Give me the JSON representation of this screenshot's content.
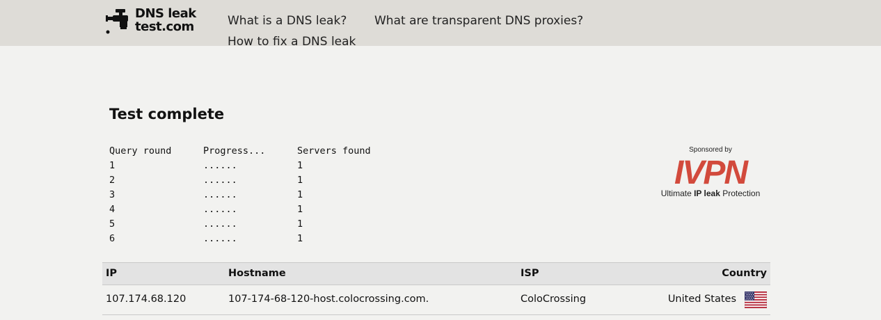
{
  "header": {
    "logo": {
      "line1": "DNS leak",
      "line2": "test.com",
      "icon": "faucet-icon"
    },
    "nav": [
      {
        "label": "What is a DNS leak?"
      },
      {
        "label": "What are transparent DNS proxies?"
      },
      {
        "label": "How to fix a DNS leak"
      }
    ]
  },
  "main": {
    "heading": "Test complete",
    "query_table": {
      "headers": [
        "Query round",
        "Progress...",
        "Servers found"
      ],
      "rows": [
        [
          "1",
          "......",
          "1"
        ],
        [
          "2",
          "......",
          "1"
        ],
        [
          "3",
          "......",
          "1"
        ],
        [
          "4",
          "......",
          "1"
        ],
        [
          "5",
          "......",
          "1"
        ],
        [
          "6",
          "......",
          "1"
        ]
      ]
    },
    "sponsor": {
      "label": "Sponsored by",
      "brand": "IVPN",
      "brand_color": "#d24a3c",
      "tagline_pre": "Ultimate ",
      "tagline_bold": "IP leak",
      "tagline_post": " Protection"
    },
    "results": {
      "headers": {
        "ip": "IP",
        "hostname": "Hostname",
        "isp": "ISP",
        "country": "Country"
      },
      "rows": [
        {
          "ip": "107.174.68.120",
          "hostname": "107-174-68-120-host.colocrossing.com.",
          "isp": "ColoCrossing",
          "country": "United States",
          "flag": "us-flag-icon"
        }
      ]
    }
  },
  "colors": {
    "header_bg": "#dedcd7",
    "page_bg": "#f2f2f0",
    "table_header_bg": "#e3e3e3"
  }
}
